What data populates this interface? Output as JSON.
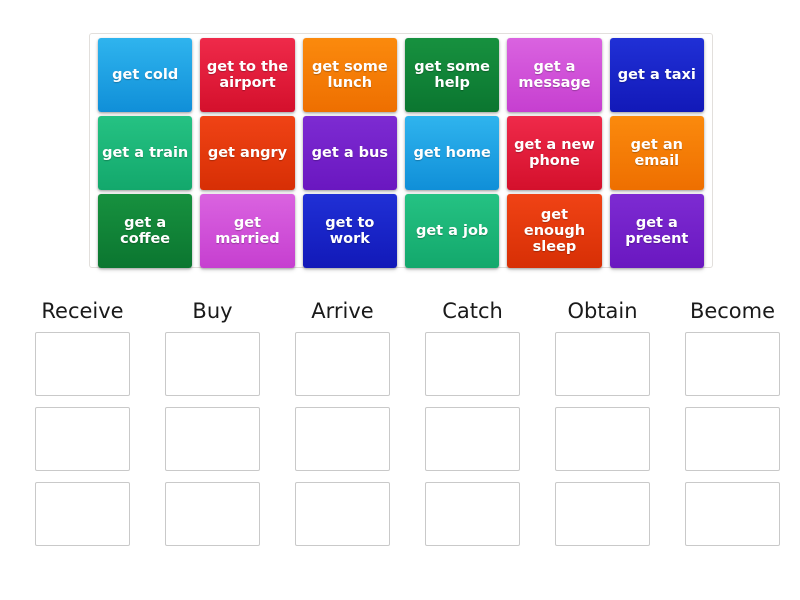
{
  "activity": {
    "type": "group-sort",
    "tray": {
      "name": "word-tiles-tray",
      "rows": 3,
      "columns": 6,
      "tiles": [
        {
          "label": "get cold",
          "color_top": "#2fb4ee",
          "color_bottom": "#108fd8",
          "color": "#1c9fe2"
        },
        {
          "label": "get to the airport",
          "color_top": "#ef2a4a",
          "color_bottom": "#d4102c",
          "color": "#e51e3c"
        },
        {
          "label": "get some lunch",
          "color_top": "#fb8a0d",
          "color_bottom": "#ee6f00",
          "color": "#f57c04"
        },
        {
          "label": "get some help",
          "color_top": "#17913f",
          "color_bottom": "#0b7630",
          "color": "#118438"
        },
        {
          "label": "get a message",
          "color_top": "#da63e0",
          "color_bottom": "#c63fd0",
          "color": "#d052d8"
        },
        {
          "label": "get a taxi",
          "color_top": "#2030d6",
          "color_bottom": "#1219b8",
          "color": "#1a26c6"
        },
        {
          "label": "get a train",
          "color_top": "#25c283",
          "color_bottom": "#13a86c",
          "color": "#1cb578"
        },
        {
          "label": "get angry",
          "color_top": "#f04315",
          "color_bottom": "#d72f05",
          "color": "#e5390d"
        },
        {
          "label": "get a bus",
          "color_top": "#7d2bd2",
          "color_bottom": "#6a17c0",
          "color": "#7421c9"
        },
        {
          "label": "get home",
          "color_top": "#2fb4ee",
          "color_bottom": "#108fd8",
          "color": "#1c9fe2"
        },
        {
          "label": "get a new phone",
          "color_top": "#ef2a4a",
          "color_bottom": "#d4102c",
          "color": "#e51e3c"
        },
        {
          "label": "get an email",
          "color_top": "#fb8a0d",
          "color_bottom": "#ee6f00",
          "color": "#f57c04"
        },
        {
          "label": "get a coffee",
          "color_top": "#17913f",
          "color_bottom": "#0b7630",
          "color": "#118438"
        },
        {
          "label": "get married",
          "color_top": "#da63e0",
          "color_bottom": "#c63fd0",
          "color": "#d052d8"
        },
        {
          "label": "get to work",
          "color_top": "#2030d6",
          "color_bottom": "#1219b8",
          "color": "#1a26c6"
        },
        {
          "label": "get a job",
          "color_top": "#25c283",
          "color_bottom": "#13a86c",
          "color": "#1cb578"
        },
        {
          "label": "get enough sleep",
          "color_top": "#f04315",
          "color_bottom": "#d72f05",
          "color": "#e5390d"
        },
        {
          "label": "get a present",
          "color_top": "#7d2bd2",
          "color_bottom": "#6a17c0",
          "color": "#7421c9"
        }
      ]
    },
    "categories": [
      {
        "label": "Receive",
        "slots": [
          "",
          "",
          ""
        ]
      },
      {
        "label": "Buy",
        "slots": [
          "",
          "",
          ""
        ]
      },
      {
        "label": "Arrive",
        "slots": [
          "",
          "",
          ""
        ]
      },
      {
        "label": "Catch",
        "slots": [
          "",
          "",
          ""
        ]
      },
      {
        "label": "Obtain",
        "slots": [
          "",
          "",
          ""
        ]
      },
      {
        "label": "Become",
        "slots": [
          "",
          "",
          ""
        ]
      }
    ],
    "theme": {
      "page_background": "#ffffff",
      "tray_border": "#e2dfdc",
      "dropzone_border": "#c9c9c9",
      "header_text": "#1a1a1a",
      "tile_text": "#ffffff"
    }
  }
}
